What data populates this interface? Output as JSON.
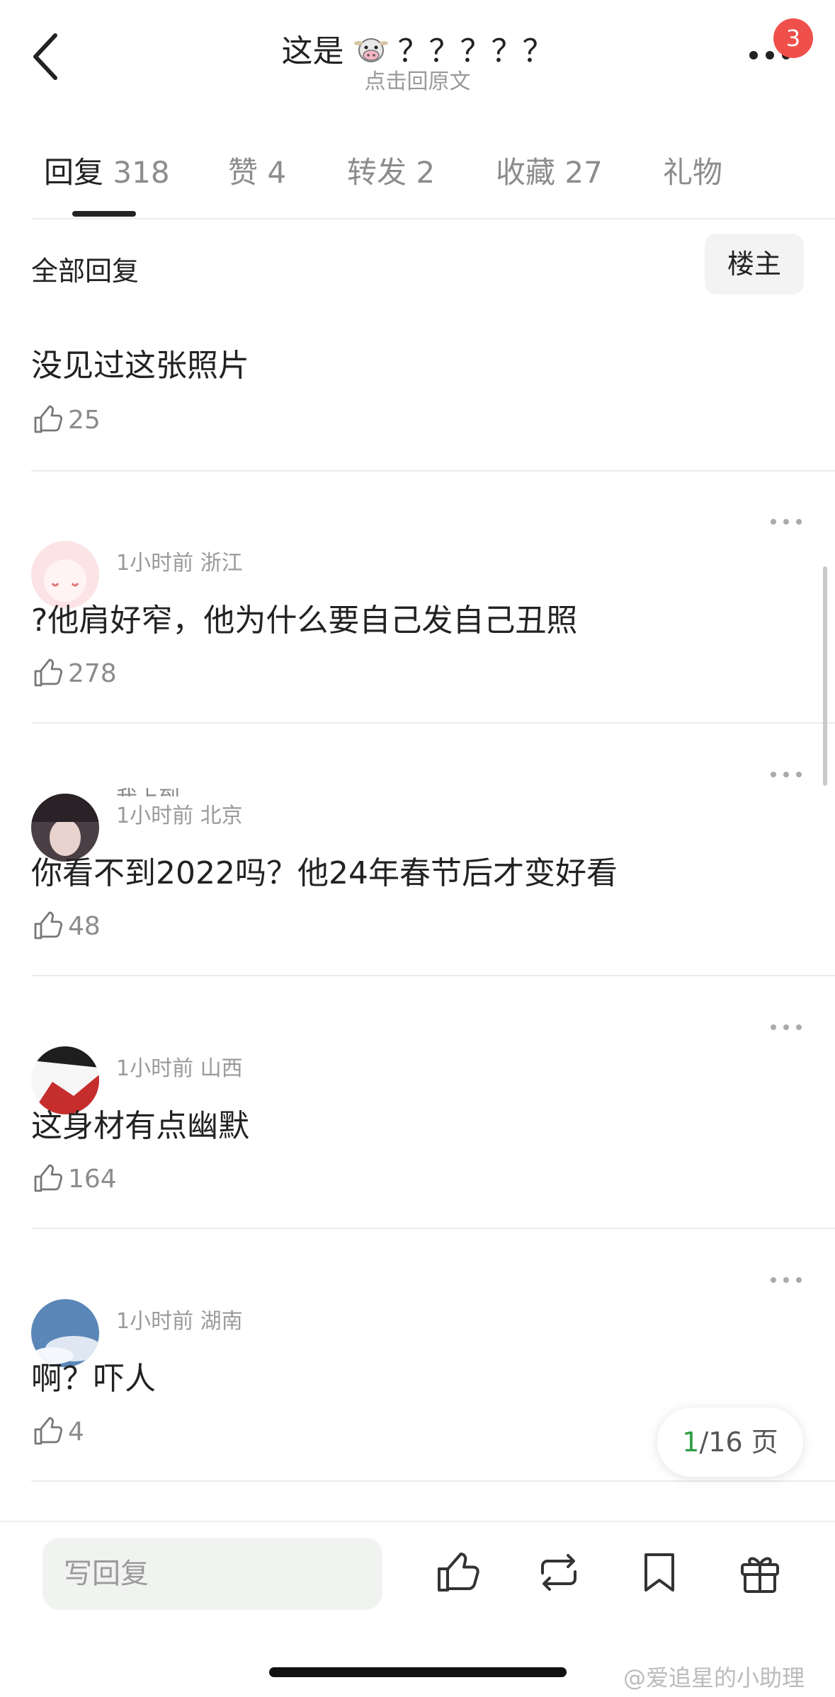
{
  "header": {
    "title_prefix": "这是",
    "title_suffix": "？？？？？",
    "subtitle": "点击回原文",
    "notification_count": "3"
  },
  "tabs": [
    {
      "label": "回复",
      "count": "318"
    },
    {
      "label": "赞",
      "count": "4"
    },
    {
      "label": "转发",
      "count": "2"
    },
    {
      "label": "收藏",
      "count": "27"
    },
    {
      "label": "礼物",
      "count": ""
    }
  ],
  "filter": {
    "label": "全部回复",
    "owner_button": "楼主"
  },
  "comments": [
    {
      "username": "",
      "meta": "",
      "text": "没见过这张照片",
      "likes": "25"
    },
    {
      "username": "",
      "meta": "1小时前 浙江",
      "text": "?他肩好窄，他为什么要自己发自己丑照",
      "likes": "278"
    },
    {
      "username": "我上到",
      "meta": "1小时前 北京",
      "text": "你看不到2022吗？他24年春节后才变好看",
      "likes": "48"
    },
    {
      "username": "",
      "meta": "1小时前 山西",
      "text": "这身材有点幽默",
      "likes": "164"
    },
    {
      "username": "",
      "meta": "1小时前 湖南",
      "text": "啊？吓人",
      "likes": "4"
    }
  ],
  "pagination": {
    "current": "1",
    "total": "/16 页"
  },
  "bottom_bar": {
    "reply_placeholder": "写回复"
  },
  "watermark": "@爱追星的小助理",
  "colors": {
    "badge": "#f0504b",
    "page_current": "#2f9e44",
    "input_bg": "#f1f3f1"
  }
}
